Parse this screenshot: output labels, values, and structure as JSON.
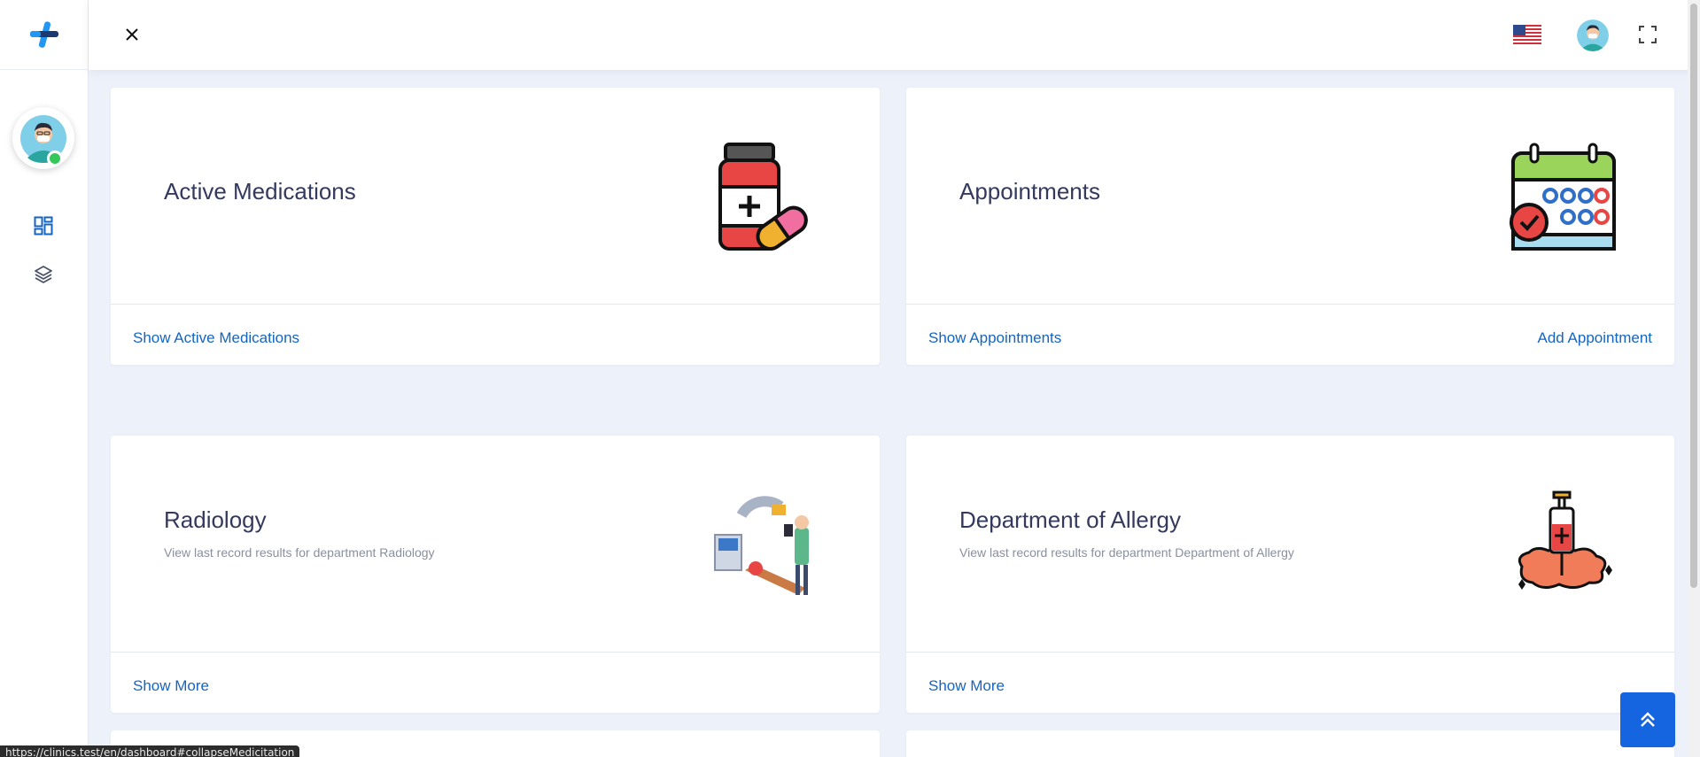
{
  "header": {
    "close_icon": "close-icon",
    "language_flag": "us-flag-icon",
    "fullscreen_icon": "fullscreen-icon"
  },
  "sidebar": {
    "items": [
      {
        "icon": "dashboard-icon"
      },
      {
        "icon": "layers-icon"
      }
    ]
  },
  "cards": {
    "medications": {
      "title": "Active Medications",
      "link": "Show Active Medications"
    },
    "appointments": {
      "title": "Appointments",
      "link": "Show Appointments",
      "link2": "Add Appointment"
    },
    "radiology": {
      "title": "Radiology",
      "subtitle": "View last record results for department Radiology",
      "link": "Show More"
    },
    "allergy": {
      "title": "Department of Allergy",
      "subtitle": "View last record results for department Department of Allergy",
      "link": "Show More"
    }
  },
  "status_bar": {
    "url": "https://clinics.test/en/dashboard#collapseMedicitation"
  },
  "colors": {
    "accent": "#1565c0",
    "background": "#edf1f9",
    "online": "#34c759"
  }
}
